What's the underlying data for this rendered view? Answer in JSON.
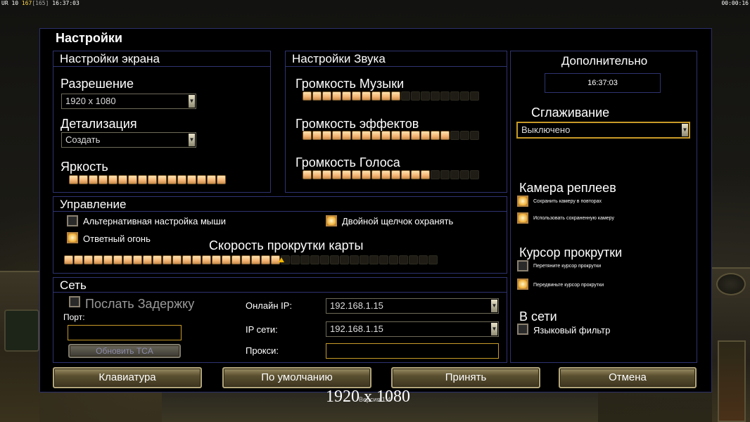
{
  "topbar": {
    "left_prefix": "UR 10 ",
    "left_y": "167",
    "left_g": "[165]",
    "left_time": " 16:37:03",
    "right_time": "00:00:16"
  },
  "dialog": {
    "title": "Настройки",
    "screen": {
      "header": "Настройки экрана",
      "resolution_label": "Разрешение",
      "resolution_value": "1920 x 1080",
      "detail_label": "Детализация",
      "detail_value": "Создать",
      "brightness_label": "Яркость",
      "brightness_level": 16,
      "brightness_max": 16
    },
    "sound": {
      "header": "Настройки Звука",
      "music_label": "Громкость Музыки",
      "music_level": 10,
      "music_max": 18,
      "effects_label": "Громкость эффектов",
      "effects_level": 15,
      "effects_max": 18,
      "voice_label": "Громкость Голоса",
      "voice_level": 13,
      "voice_max": 18
    },
    "extra": {
      "header": "Дополнительно",
      "clock": "16:37:03",
      "antialias_label": "Сглаживание",
      "antialias_value": "Выключено",
      "replay_cam_label": "Камера реплеев",
      "replay_save": "Сохранить камеру в повторах",
      "replay_use": "Использовать сохраненную камеру",
      "scroll_cursor_label": "Курсор прокрутки",
      "cursor_drag": "Перетяните курсор прокрутки",
      "cursor_move": "Передвиньте курсор прокрутки",
      "online_label": "В сети",
      "lang_filter": "Языковый фильтр"
    },
    "control": {
      "header": "Управление",
      "alt_mouse": "Альтернативная настройка мыши",
      "double_click": "Двойной щелчок охранять",
      "return_fire": "Ответный огонь",
      "scroll_speed_label": "Скорость прокрутки карты",
      "scroll_level": 22,
      "scroll_max": 38
    },
    "network": {
      "header": "Сеть",
      "send_delay": "Послать Задержку",
      "port_label": "Порт:",
      "update_tca": "Обновить TCA",
      "online_ip_label": "Онлайн IP:",
      "online_ip_value": "192.168.1.15",
      "lan_ip_label": "IP сети:",
      "lan_ip_value": "192.168.1.15",
      "proxy_label": "Прокси:"
    },
    "buttons": {
      "keyboard": "Клавиатура",
      "defaults": "По умолчанию",
      "accept": "Принять",
      "cancel": "Отмена"
    }
  },
  "footer": {
    "resolution": "1920 x 1080",
    "version": "Версия 1.4"
  },
  "colors": {
    "panel_border": "#2e3370",
    "gold_border": "#c89a28",
    "slider_on": "#f4b474",
    "slider_off": "#1e1c14"
  }
}
